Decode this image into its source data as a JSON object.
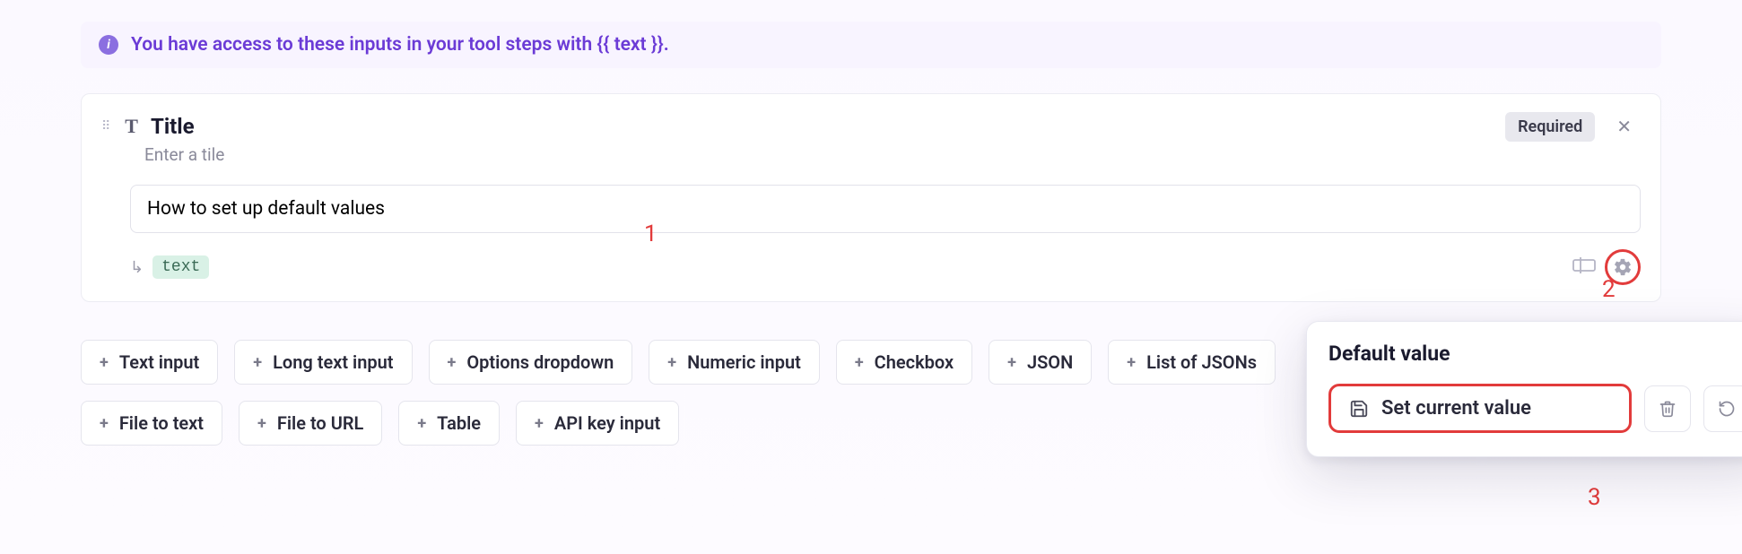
{
  "info_bar": {
    "text": "You have access to these inputs in your tool steps with {{ text }}."
  },
  "card": {
    "title": "Title",
    "subtitle": "Enter a tile",
    "badge": "Required",
    "input_value": "How to set up default values",
    "var_chip": "text"
  },
  "callouts": {
    "n1": "1",
    "n2": "2",
    "n3": "3"
  },
  "input_types": [
    "Text input",
    "Long text input",
    "Options dropdown",
    "Numeric input",
    "Checkbox",
    "JSON",
    "List of JSONs",
    "File to text",
    "File to URL",
    "Table",
    "API key input"
  ],
  "popover": {
    "heading": "Default value",
    "primary": "Set current value"
  }
}
